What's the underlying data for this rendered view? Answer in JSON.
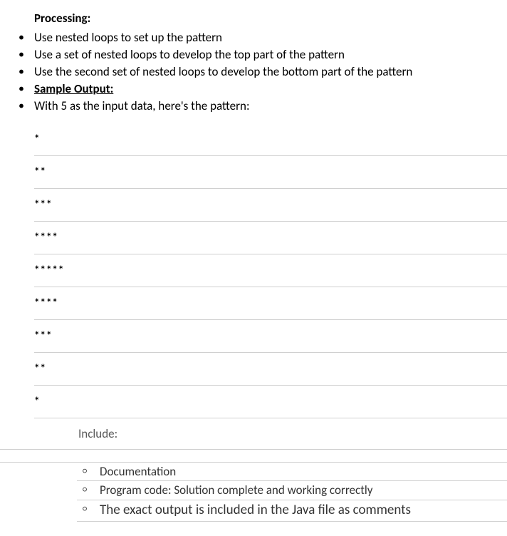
{
  "heading": "Processing:",
  "bullets": [
    "Use nested loops to set up the pattern",
    "Use a set of nested loops to develop the top part of the pattern",
    "Use the second set of nested loops to develop the bottom part of the pattern"
  ],
  "sample_output_label": "Sample Output:",
  "sample_output_intro": "With 5 as the input data, here's the pattern:",
  "pattern_lines": [
    "*",
    "**",
    "***",
    "****",
    "*****",
    "****",
    "***",
    "**",
    "*"
  ],
  "include_heading": "Include:",
  "include_items": [
    "Documentation",
    "Program code: Solution complete and working correctly",
    "The exact output is included in the Java file as comments"
  ]
}
